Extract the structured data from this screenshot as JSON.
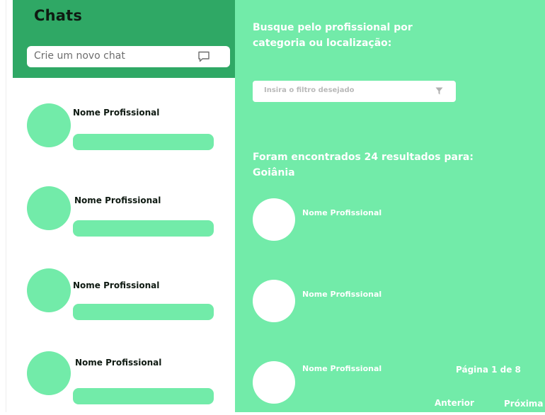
{
  "chats": {
    "title": "Chats",
    "new_chat_placeholder": "Crie um novo chat",
    "items": [
      {
        "name": "Nome Profissional"
      },
      {
        "name": "Nome Profissional"
      },
      {
        "name": "Nome Profissional"
      },
      {
        "name": "Nome Profissional"
      }
    ]
  },
  "search": {
    "prompt": "Busque pelo profissional por categoria ou localização:",
    "filter_placeholder": "Insira o filtro desejado",
    "results_text": "Foram encontrados 24 resultados para: Goiânia",
    "results": [
      {
        "name": "Nome Profissional"
      },
      {
        "name": "Nome Profissional"
      },
      {
        "name": "Nome Profissional"
      }
    ],
    "pagination": {
      "page_info": "Página 1 de 8",
      "prev_label": "Anterior",
      "next_label": "Próxima"
    }
  },
  "colors": {
    "header_green": "#2fa865",
    "accent_green": "#72eba9",
    "white": "#ffffff"
  }
}
